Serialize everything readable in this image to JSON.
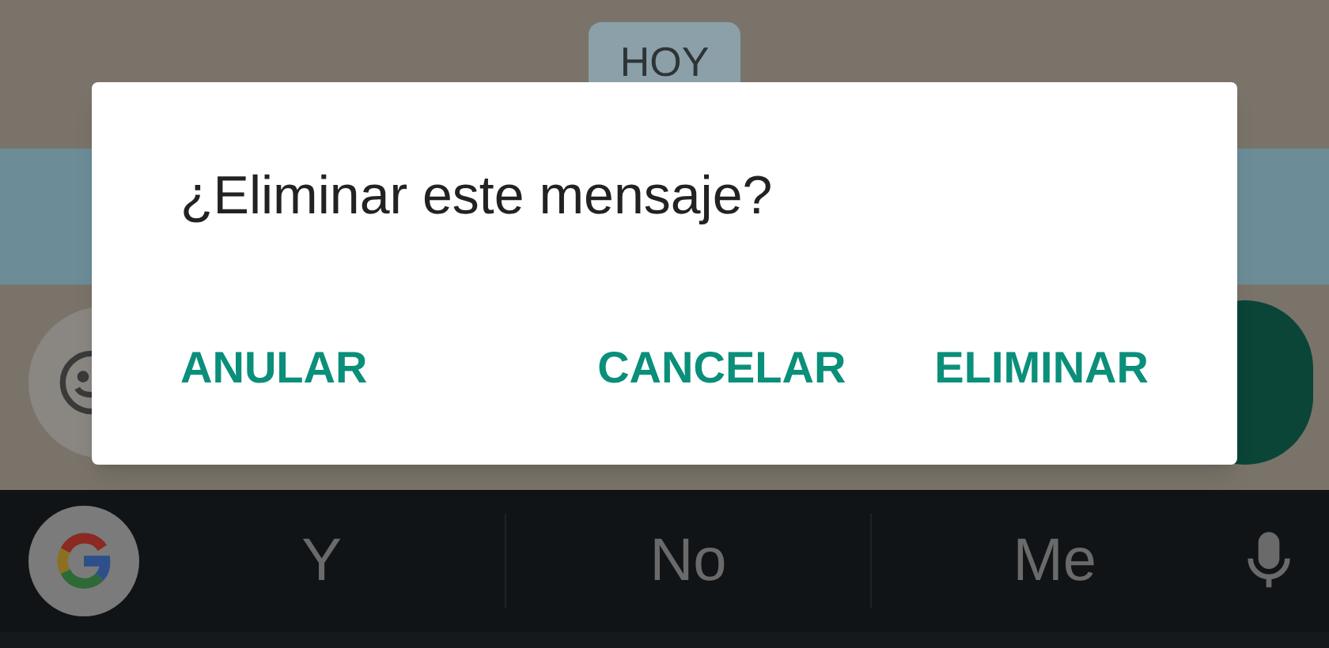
{
  "chat": {
    "date_chip": "HOY"
  },
  "dialog": {
    "message": "¿Eliminar este mensaje?",
    "buttons": [
      "ANULAR",
      "CANCELAR",
      "ELIMINAR"
    ]
  },
  "keyboard": {
    "suggestions": [
      "Y",
      "No",
      "Me"
    ]
  }
}
